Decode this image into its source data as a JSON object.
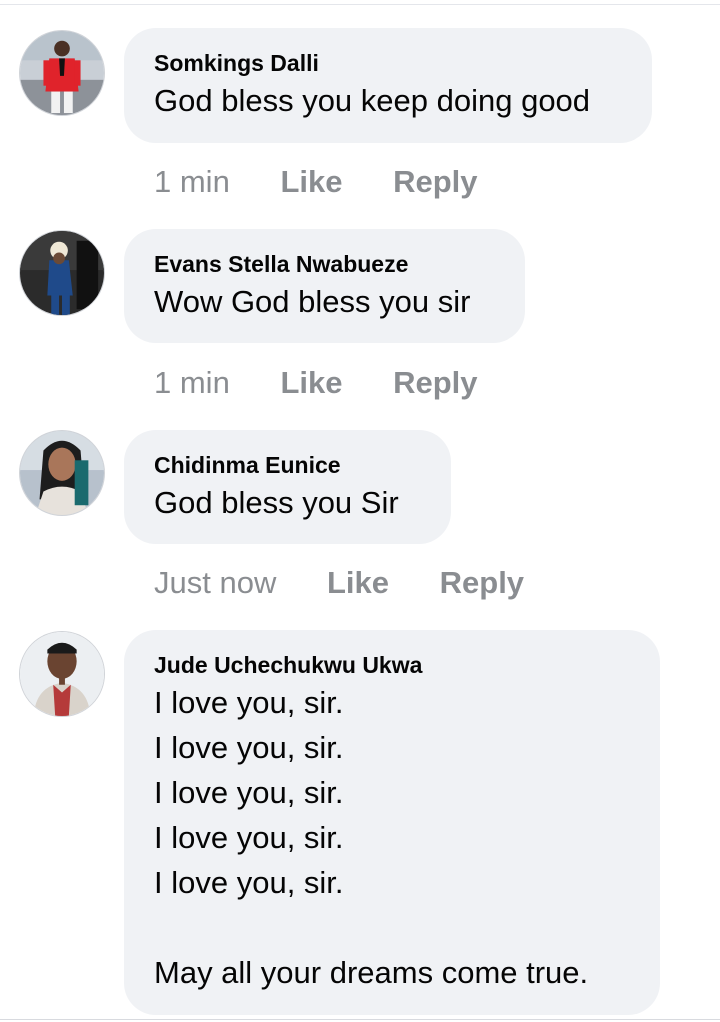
{
  "comments": [
    {
      "author": "Somkings Dalli",
      "text": "God bless you keep doing good",
      "time": "1 min",
      "like_label": "Like",
      "reply_label": "Reply"
    },
    {
      "author": "Evans Stella Nwabueze",
      "text": "Wow God bless you sir",
      "time": "1 min",
      "like_label": "Like",
      "reply_label": "Reply"
    },
    {
      "author": "Chidinma Eunice",
      "text": "God bless you Sir",
      "time": "Just now",
      "like_label": "Like",
      "reply_label": "Reply"
    },
    {
      "author": "Jude Uchechukwu Ukwa",
      "text": "I love you, sir.\nI love you, sir.\nI love you, sir.\nI love you, sir.\nI love you, sir.\n\nMay all your dreams come true."
    }
  ],
  "colors": {
    "bubble": "#f0f2f5",
    "meta_text": "#8a8d91",
    "text": "#050505"
  }
}
